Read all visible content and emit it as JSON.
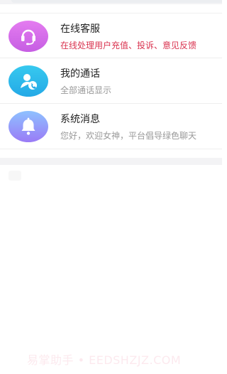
{
  "messages": [
    {
      "title": "在线客服",
      "subtitle": "在线处理用户充值、投诉、意见反馈",
      "subtitle_color": "#d9334f",
      "icon": "headset-icon"
    },
    {
      "title": "我的通话",
      "subtitle": "全部通话显示",
      "subtitle_color": "#999999",
      "icon": "user-phone-icon"
    },
    {
      "title": "系统消息",
      "subtitle": "您好，欢迎女神，平台倡导绿色聊天",
      "subtitle_color": "#999999",
      "icon": "bell-icon"
    }
  ],
  "watermark": "易掌助手 • EEDSHZJZ.COM"
}
